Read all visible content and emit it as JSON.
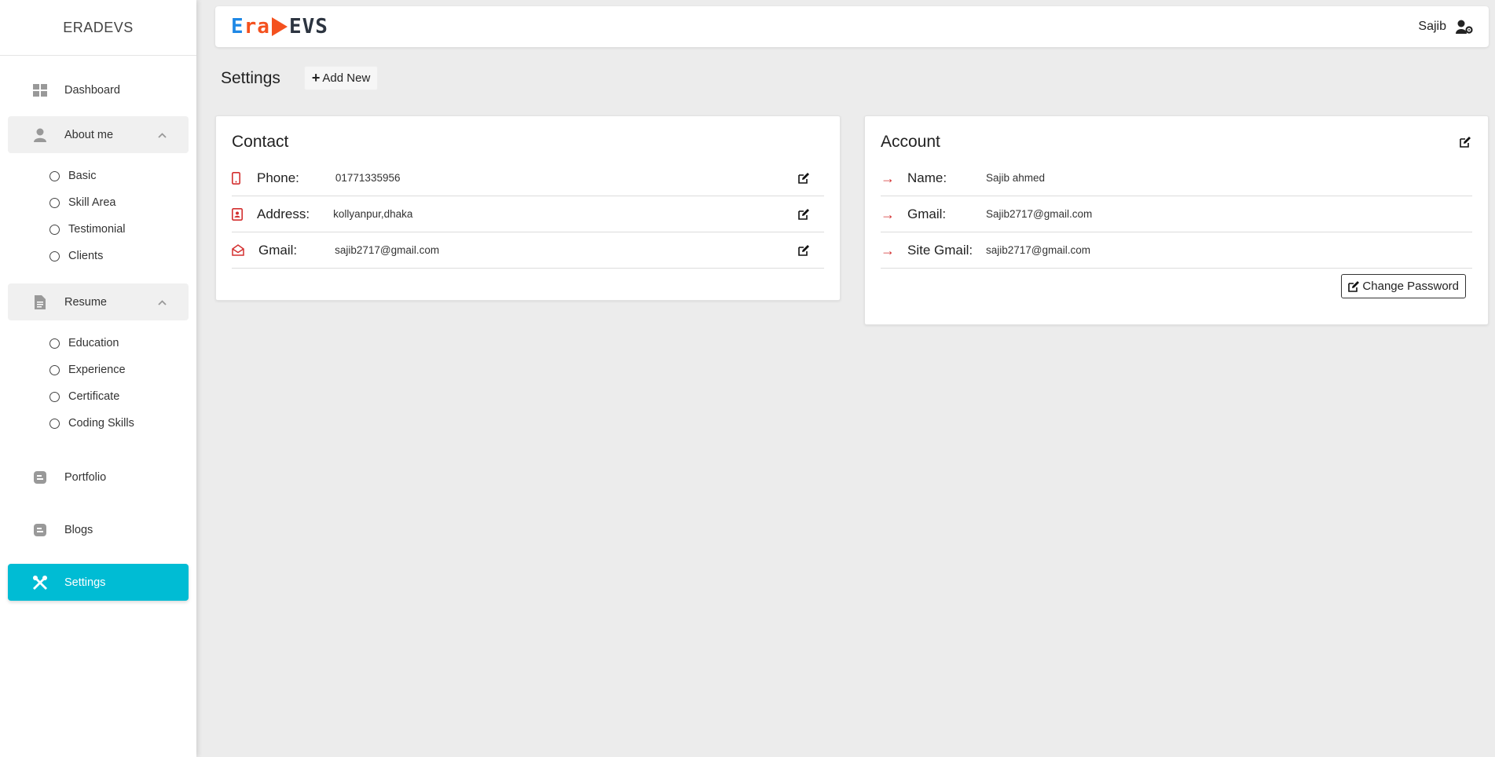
{
  "sidebar": {
    "brand": "ERADEVS",
    "dashboard": "Dashboard",
    "about": {
      "label": "About me",
      "items": [
        "Basic",
        "Skill Area",
        "Testimonial",
        "Clients"
      ]
    },
    "resume": {
      "label": "Resume",
      "items": [
        "Education",
        "Experience",
        "Certificate",
        "Coding Skills"
      ]
    },
    "portfolio": "Portfolio",
    "blogs": "Blogs",
    "settings": "Settings",
    "accent": "#00bcd4"
  },
  "topbar": {
    "logo": {
      "e": "E",
      "ra": "ra",
      "devs": "EVS"
    },
    "user": "Sajib"
  },
  "page": {
    "title": "Settings",
    "add_new": "Add New"
  },
  "contact": {
    "title": "Contact",
    "rows": [
      {
        "label": "Phone:",
        "value": "01771335956",
        "icon": "mobile-icon"
      },
      {
        "label": "Address:",
        "value": "kollyanpur,dhaka",
        "icon": "address-book-icon"
      },
      {
        "label": "Gmail:",
        "value": "sajib2717@gmail.com",
        "icon": "envelope-open-icon"
      }
    ]
  },
  "account": {
    "title": "Account",
    "rows": [
      {
        "label": "Name:",
        "value": "Sajib ahmed"
      },
      {
        "label": "Gmail:",
        "value": "Sajib2717@gmail.com"
      },
      {
        "label": "Site Gmail:",
        "value": "sajib2717@gmail.com"
      }
    ],
    "change_password": "Change Password"
  },
  "colors": {
    "icon_red": "#d32f2f",
    "logo_blue": "#1e88e5",
    "logo_orange": "#f4511e"
  }
}
